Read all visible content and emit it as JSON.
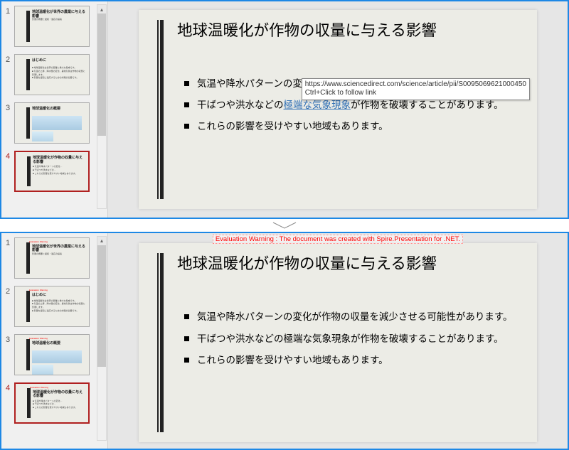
{
  "slide_title": "地球温暖化が作物の収量に与える影響",
  "bullets": {
    "b1_pre": "気温や降水パターンの変化が",
    "b1_link": "作物の収量を減少",
    "b1_post": "させる可能性があります。",
    "b2_pre": "干ばつや洪水などの",
    "b2_link": "極端な気象現象",
    "b2_post": "が作物を破壊することがあります。",
    "b3": "これらの影響を受けやすい地域もあります。",
    "b1_plain": "気温や降水パターンの変化が作物の収量を減少させる可能性があります。",
    "b2_plain": "干ばつや洪水などの極端な気象現象が作物を破壊することがあります。"
  },
  "tooltip": {
    "url": "https://www.sciencedirect.com/science/article/pii/S0095069621000450",
    "hint": "Ctrl+Click to follow link"
  },
  "eval_warning": "Evaluation Warning : The document was created with  Spire.Presentation for .NET.",
  "thumbs": [
    {
      "num": "1",
      "title": "地球温暖化が世界の農業に与える影響",
      "sub": "影響の概要と緩和・適応の提案"
    },
    {
      "num": "2",
      "title": "はじめに",
      "sub": "■ 地球温暖化は世界の農業に重大な脅威です。\n■ 気温の上昇、降水量の変化、異常気象は作物の収量に影響します。\n■ 影響を緩和し適応するための対策が必要です。"
    },
    {
      "num": "3",
      "title": "地球温暖化の概要",
      "sub": ""
    },
    {
      "num": "4",
      "title": "地球温暖化が作物の収量に与える影響",
      "sub": "■ 気温や降水パターンの変化…\n■ 干ばつや洪水などの…\n■ これらの影響を受けやすい地域もあります。"
    }
  ]
}
